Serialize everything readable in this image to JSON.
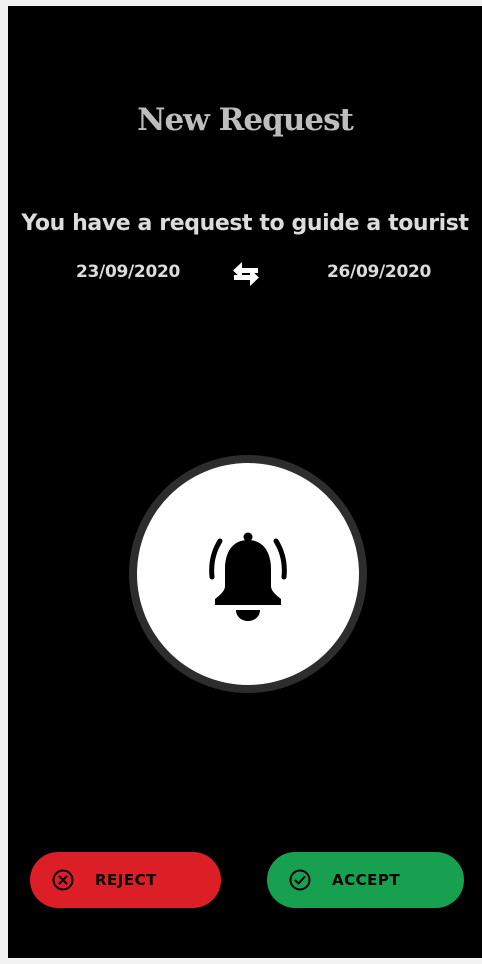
{
  "screen": {
    "title": "New Request",
    "message": "You have a request to guide a tourist",
    "date_from": "23/09/2020",
    "date_to": "26/09/2020",
    "swap_icon": "swap-arrows-icon",
    "bell_icon": "bell-ringing-icon"
  },
  "actions": {
    "reject_label": "REJECT",
    "reject_icon": "close-circle-icon",
    "accept_label": "ACCEPT",
    "accept_icon": "check-circle-icon"
  },
  "colors": {
    "background": "#000000",
    "reject": "#dc1f26",
    "accept": "#17a04f",
    "text": "#dcdcdc"
  }
}
